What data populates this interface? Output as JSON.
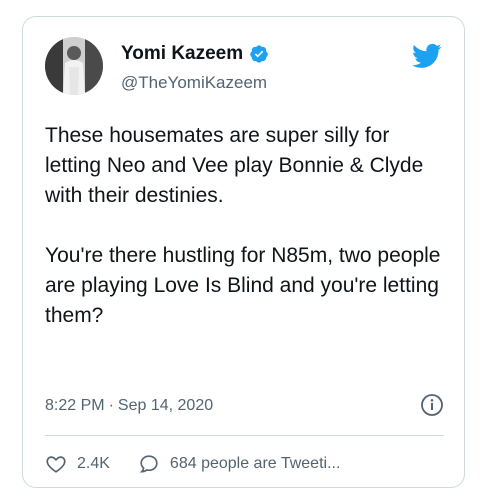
{
  "tweet": {
    "author_name": "Yomi Kazeem",
    "handle": "@TheYomiKazeem",
    "text": "These housemates are super silly for letting Neo and Vee play Bonnie & Clyde with their destinies.\n\nYou're there hustling for N85m, two people are playing Love Is Blind and you're letting them?",
    "time": "8:22 PM",
    "separator": "·",
    "date": "Sep 14, 2020",
    "likes": "2.4K",
    "replies_label": "684 people are Tweeti..."
  },
  "icons": {
    "verified": "verified-badge-icon",
    "platform": "twitter-bird-icon",
    "info": "info-icon",
    "like": "heart-icon",
    "reply": "speech-bubble-icon"
  },
  "colors": {
    "accent": "#1da1f2",
    "text": "#0f1419",
    "muted": "#536471",
    "border": "#cfd9de"
  }
}
